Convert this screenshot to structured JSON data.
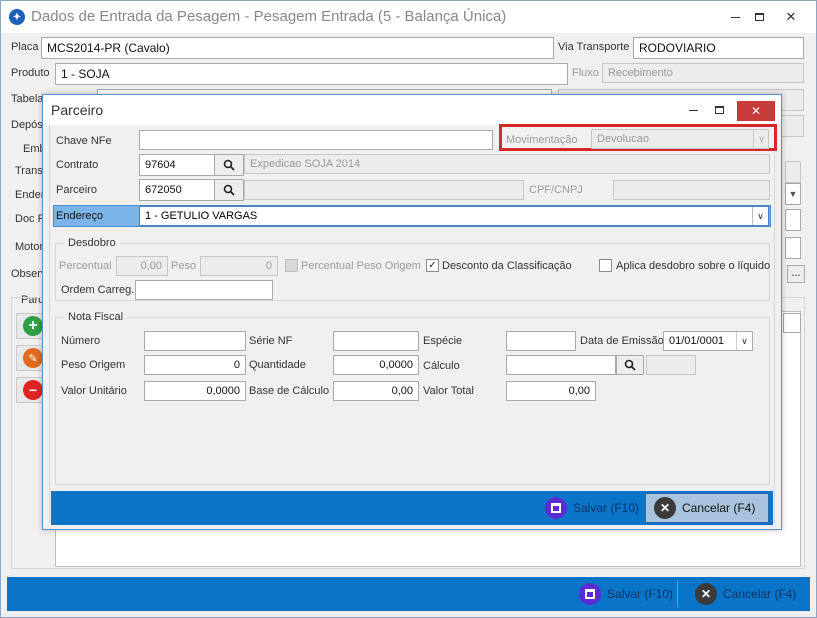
{
  "main_window": {
    "title": "Dados de Entrada da Pesagem - Pesagem Entrada (5 - Balança Única)",
    "placa_label": "Placa",
    "placa_value": "MCS2014-PR (Cavalo)",
    "via_transporte_label": "Via Transporte",
    "via_transporte_value": "RODOVIARIO",
    "produto_label": "Produto",
    "produto_value": "1 - SOJA",
    "fluxo_label": "Fluxo",
    "fluxo_value": "Recebimento",
    "tabela_label": "Tabela",
    "deposito_label": "Depós",
    "emb_label": "Emb",
    "transp_label": "Transp",
    "ender_label": "Ender",
    "doc_label": "Doc Fi",
    "motor_label": "Motor",
    "observ_label": "Observ",
    "parc_label": "Parc",
    "dots_label": "...",
    "salvar_label": "Salvar (F10)",
    "cancelar_label": "Cancelar (F4)"
  },
  "dialog": {
    "title": "Parceiro",
    "chave_nfe_label": "Chave NFe",
    "chave_nfe_value": "",
    "movimentacao_label": "Movimentação",
    "movimentacao_value": "Devolucao",
    "contrato_label": "Contrato",
    "contrato_value": "97604",
    "contrato_desc": "Expedicao SOJA 2014",
    "parceiro_label": "Parceiro",
    "parceiro_value": "672050",
    "parceiro_desc": "",
    "cpf_cnpj_label": "CPF/CNPJ",
    "cpf_cnpj_value": "",
    "endereco_label": "Endereço",
    "endereco_value": "1 - GETULIO VARGAS",
    "desdobro": {
      "legend": "Desdobro",
      "percentual_label": "Percentual",
      "percentual_value": "0,00",
      "peso_label": "Peso",
      "peso_value": "0",
      "percentual_peso_origem_label": "Percentual Peso Origem",
      "percentual_peso_origem_checked": false,
      "desconto_classificacao_label": "Desconto da Classificação",
      "desconto_classificacao_checked": true,
      "aplica_desdobro_label": "Aplica desdobro sobre o líquido",
      "aplica_desdobro_checked": false,
      "ordem_carreg_label": "Ordem Carreg.",
      "ordem_carreg_value": ""
    },
    "nota_fiscal": {
      "legend": "Nota Fiscal",
      "numero_label": "Número",
      "numero_value": "",
      "serie_nf_label": "Série NF",
      "serie_nf_value": "",
      "especie_label": "Espécie",
      "especie_value": "",
      "data_emissao_label": "Data de Emissão",
      "data_emissao_value": "01/01/0001",
      "peso_origem_label": "Peso Origem",
      "peso_origem_value": "0",
      "quantidade_label": "Quantidade",
      "quantidade_value": "0,0000",
      "calculo_label": "Cálculo",
      "calculo_value": "",
      "valor_unitario_label": "Valor Unitário",
      "valor_unitario_value": "0,0000",
      "base_calculo_label": "Base de Cálculo",
      "base_calculo_value": "0,00",
      "valor_total_label": "Valor Total",
      "valor_total_value": "0,00"
    },
    "salvar_label": "Salvar (F10)",
    "cancelar_label": "Cancelar (F4)"
  },
  "colors": {
    "footer_blue": "#0a74c9",
    "highlight_red": "#d62828",
    "close_red": "#c73a3a",
    "selected_row": "#7ab4e8",
    "save_icon": "#5b2bd6",
    "cancel_icon": "#3b3b3b"
  },
  "icons": {
    "app": "app-logo-icon",
    "search": "search-icon",
    "add": "add-icon",
    "edit": "edit-icon",
    "remove": "remove-icon",
    "save": "save-icon",
    "cancel": "cancel-icon"
  }
}
